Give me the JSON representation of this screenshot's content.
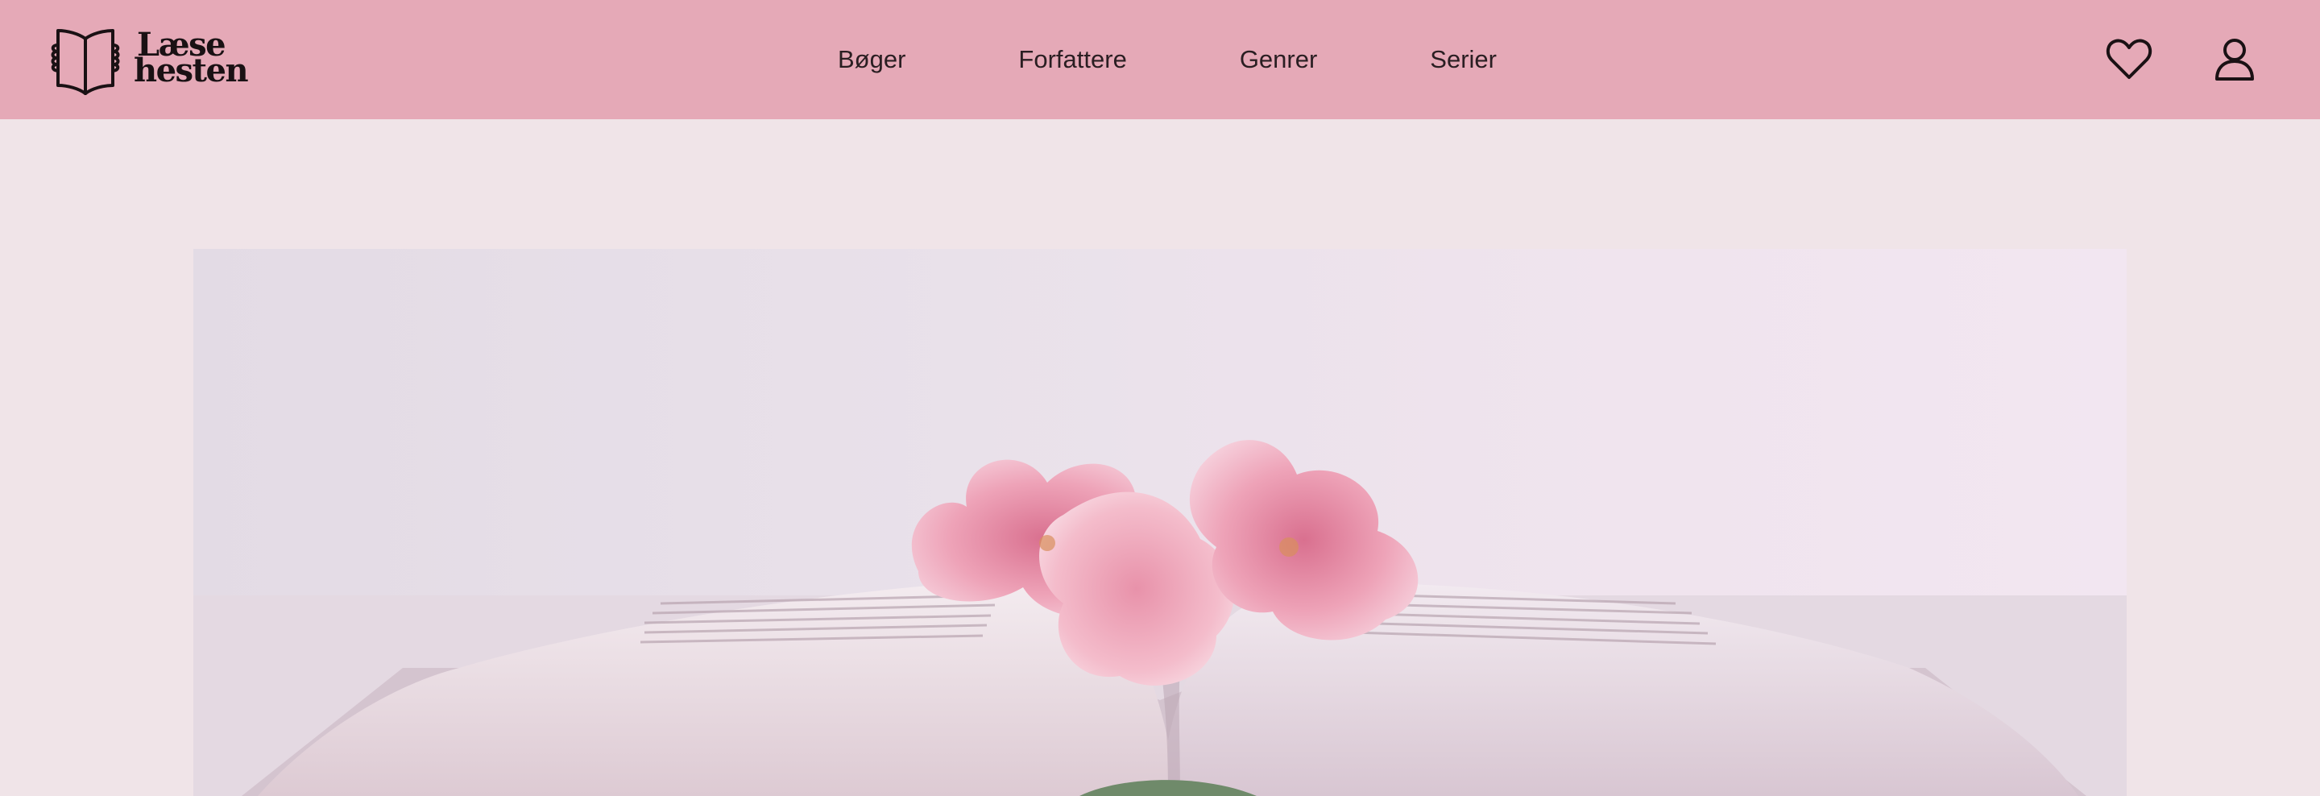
{
  "header": {
    "logo": {
      "text_line1": "Læse",
      "text_line2": "hesten",
      "icon": "open-book-icon"
    },
    "nav": [
      {
        "label": "Bøger"
      },
      {
        "label": "Forfattere"
      },
      {
        "label": "Genrer"
      },
      {
        "label": "Serier"
      }
    ],
    "actions": [
      {
        "icon": "heart-icon"
      },
      {
        "icon": "user-icon"
      }
    ]
  },
  "hero": {
    "image": "open-book-with-pink-flowers"
  },
  "colors": {
    "header_bg": "#e5a9b7",
    "page_bg": "#f0e4e8",
    "text": "#2a1e22"
  }
}
